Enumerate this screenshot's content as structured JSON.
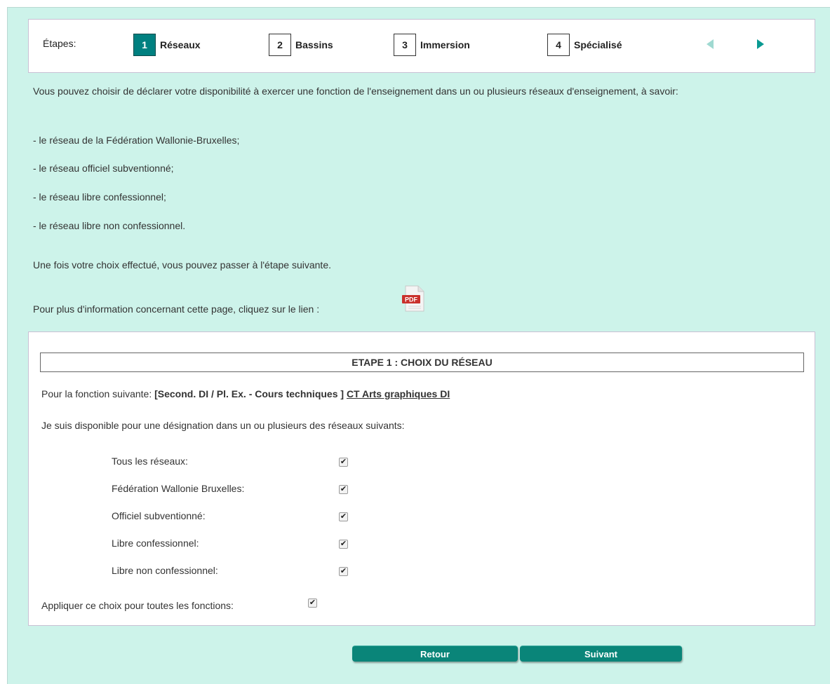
{
  "steps": {
    "title": "Étapes:",
    "items": [
      {
        "num": "1",
        "label": "Réseaux",
        "active": true
      },
      {
        "num": "2",
        "label": "Bassins",
        "active": false
      },
      {
        "num": "3",
        "label": "Immersion",
        "active": false
      },
      {
        "num": "4",
        "label": "Spécialisé",
        "active": false
      }
    ],
    "prev_icon": "arrow-left-icon",
    "next_icon": "arrow-right-icon"
  },
  "intro": {
    "p1": "Vous pouvez choisir de déclarer votre disponibilité à exercer une fonction de l'enseignement dans un ou plusieurs réseaux d'enseignement, à savoir:",
    "networks": [
      "- le réseau de la Fédération Wallonie-Bruxelles;",
      "- le réseau officiel subventionné;",
      "- le réseau libre confessionnel;",
      "- le réseau libre non confessionnel."
    ],
    "p2": "Une fois votre choix effectué, vous pouvez passer à l'étape suivante.",
    "info_text": "Pour plus d'information concernant cette page, cliquez sur le lien :",
    "pdf_label": "PDF"
  },
  "form": {
    "title": "ETAPE 1 : CHOIX DU RÉSEAU",
    "function_prefix": "Pour la fonction suivante: ",
    "function_bold": "[Second. DI / Pl. Ex. - Cours techniques ]",
    "function_link": "CT Arts graphiques DI",
    "availability": "Je suis disponible pour une désignation dans un ou plusieurs des réseaux suivants:",
    "options": [
      {
        "label": "Tous les réseaux:",
        "checked": true
      },
      {
        "label": "Fédération Wallonie Bruxelles:",
        "checked": true
      },
      {
        "label": "Officiel subventionné:",
        "checked": true
      },
      {
        "label": "Libre confessionnel:",
        "checked": true
      },
      {
        "label": "Libre non confessionnel:",
        "checked": true
      }
    ],
    "apply_all": {
      "label": "Appliquer ce choix pour toutes les fonctions:",
      "checked": true
    }
  },
  "buttons": {
    "back": "Retour",
    "next": "Suivant"
  },
  "colors": {
    "background": "#cdf3ea",
    "accent": "#008080",
    "button": "#0a8579"
  }
}
